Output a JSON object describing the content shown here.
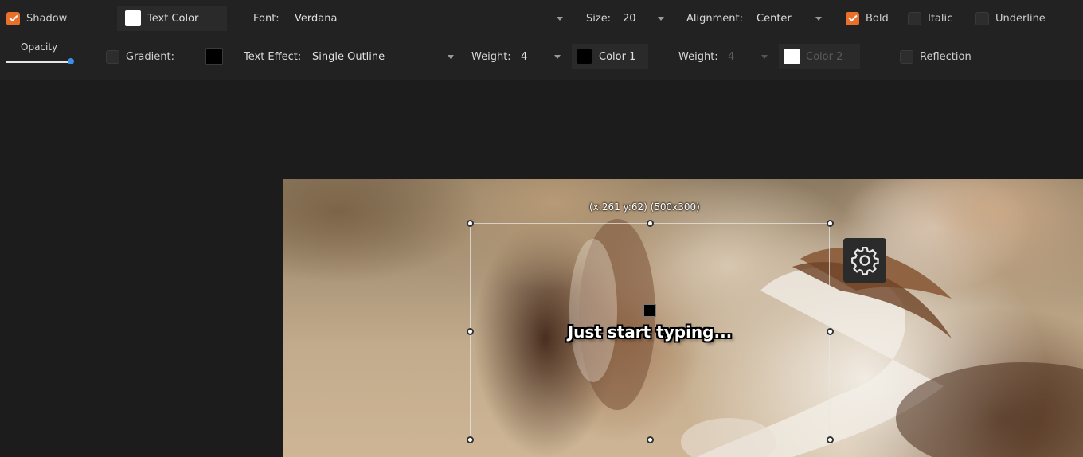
{
  "toolbar_row1": {
    "shadow_label": "Shadow",
    "text_color_label": "Text Color",
    "font_label": "Font:",
    "font_value": "Verdana",
    "size_label": "Size:",
    "size_value": "20",
    "alignment_label": "Alignment:",
    "alignment_value": "Center",
    "bold_label": "Bold",
    "italic_label": "Italic",
    "underline_label": "Underline"
  },
  "toolbar_row2": {
    "opacity_label": "Opacity",
    "opacity_level": 1.0,
    "gradient_label": "Gradient:",
    "text_effect_label": "Text Effect:",
    "text_effect_value": "Single Outline",
    "weight1_label": "Weight:",
    "weight1_value": "4",
    "color1_label": "Color 1",
    "weight2_label": "Weight:",
    "weight2_value": "4",
    "color2_label": "Color 2",
    "reflection_label": "Reflection"
  },
  "states": {
    "shadow_checked": true,
    "bold_checked": true,
    "italic_checked": false,
    "underline_checked": false,
    "gradient_checked": false,
    "reflection_checked": false
  },
  "colors": {
    "accent": "#e8702a",
    "text_color": "#ffffff",
    "gradient_color": "#000000",
    "color1": "#000000",
    "color2": "#ffffff",
    "slider_thumb": "#3a8ee6"
  },
  "editor": {
    "coords_text": "(x:261 y:62) (500x300)",
    "sample_text": "Just start typing..."
  },
  "icons": [
    "checkbox-icon",
    "caret-down-icon",
    "gear-icon"
  ]
}
